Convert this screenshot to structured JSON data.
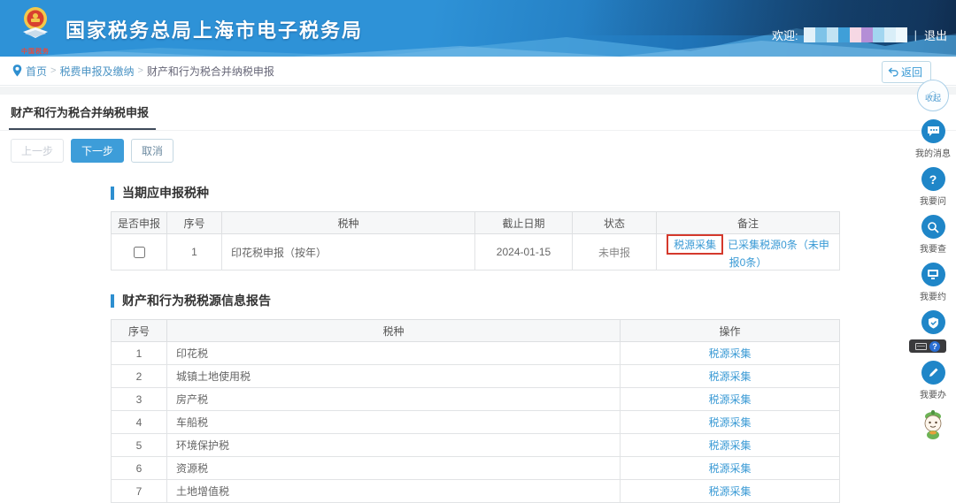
{
  "header": {
    "title": "国家税务总局上海市电子税务局",
    "logo_caption": "中国税务",
    "welcome_label": "欢迎:",
    "logout_label": "退出",
    "redacted_colors": [
      "#e2f1f9",
      "#7ec3e8",
      "#c2e3f3",
      "#3f9fd8",
      "#f6d8e4",
      "#b48ed6",
      "#a2d6f0",
      "#d9eef8",
      "#eef8fd"
    ]
  },
  "breadcrumb": {
    "items": [
      "首页",
      "税费申报及缴纳",
      "财产和行为税合并纳税申报"
    ],
    "back_label": "返回"
  },
  "tab": {
    "label": "财产和行为税合并纳税申报"
  },
  "toolbar": {
    "prev_label": "上一步",
    "next_label": "下一步",
    "cancel_label": "取消"
  },
  "section1": {
    "title": "当期应申报税种",
    "table": {
      "headers": [
        "是否申报",
        "序号",
        "税种",
        "截止日期",
        "状态",
        "备注"
      ],
      "row": {
        "seq": "1",
        "tax_type": "印花税申报（按年）",
        "deadline": "2024-01-15",
        "status": "未申报",
        "remark_link": "税源采集",
        "remark_text": "已采集税源0条（未申报0条）"
      }
    }
  },
  "section2": {
    "title": "财产和行为税税源信息报告",
    "table": {
      "headers": [
        "序号",
        "税种",
        "操作"
      ],
      "action_label": "税源采集",
      "rows": [
        {
          "seq": "1",
          "tax_type": "印花税"
        },
        {
          "seq": "2",
          "tax_type": "城镇土地使用税"
        },
        {
          "seq": "3",
          "tax_type": "房产税"
        },
        {
          "seq": "4",
          "tax_type": "车船税"
        },
        {
          "seq": "5",
          "tax_type": "环境保护税"
        },
        {
          "seq": "6",
          "tax_type": "资源税"
        },
        {
          "seq": "7",
          "tax_type": "土地增值税"
        }
      ]
    }
  },
  "sidebar": {
    "collapse_label": "收起",
    "items": [
      {
        "icon": "chat-icon",
        "label": "我的消息"
      },
      {
        "icon": "question-icon",
        "label": "我要问"
      },
      {
        "icon": "search-icon",
        "label": "我要查"
      },
      {
        "icon": "screen-icon",
        "label": "我要约"
      },
      {
        "icon": "shield-icon",
        "label": ""
      },
      {
        "icon": "pencil-icon",
        "label": "我要办"
      }
    ]
  },
  "colors": {
    "accent_blue": "#2e8fd0",
    "link_blue": "#3a9ad5",
    "highlight_red": "#d4392c",
    "next_button": "#3d9dd9",
    "header_dark": "#14426f"
  }
}
